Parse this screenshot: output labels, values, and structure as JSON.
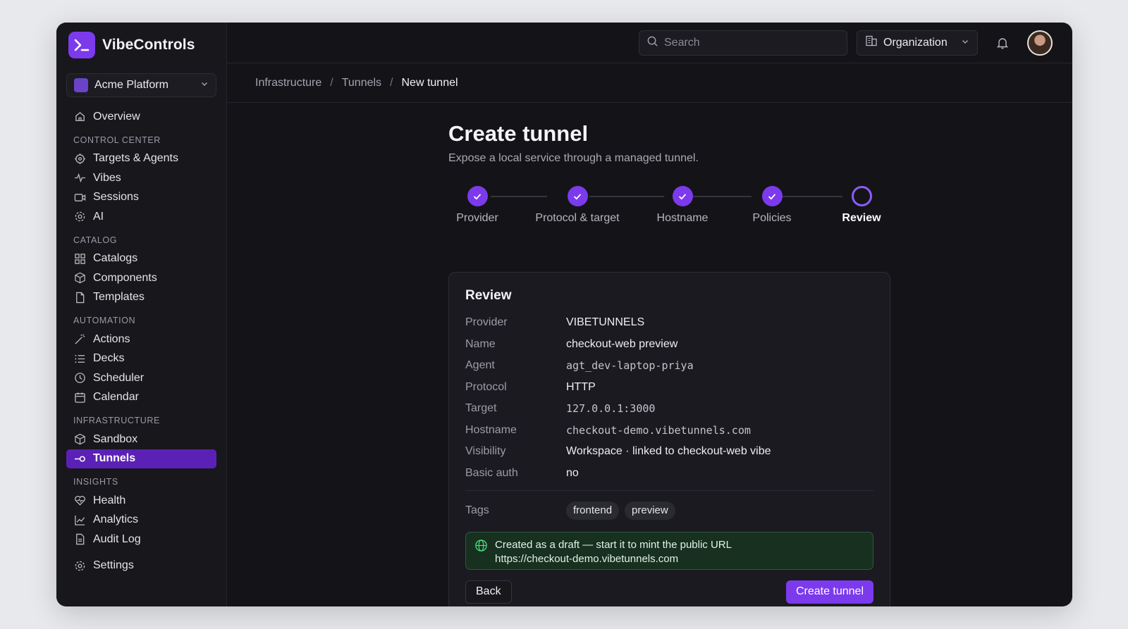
{
  "brand": {
    "name": "VibeControls",
    "logo_icon": "terminal-prompt-icon"
  },
  "workspace": {
    "name": "Acme Platform"
  },
  "sidebar": {
    "overview": "Overview",
    "sections": [
      {
        "label": "CONTROL CENTER",
        "items": [
          "Targets & Agents",
          "Vibes",
          "Sessions",
          "AI"
        ]
      },
      {
        "label": "CATALOG",
        "items": [
          "Catalogs",
          "Components",
          "Templates"
        ]
      },
      {
        "label": "AUTOMATION",
        "items": [
          "Actions",
          "Decks",
          "Scheduler",
          "Calendar"
        ]
      },
      {
        "label": "INFRASTRUCTURE",
        "items": [
          "Sandbox",
          "Tunnels"
        ]
      },
      {
        "label": "INSIGHTS",
        "items": [
          "Health",
          "Analytics",
          "Audit Log"
        ]
      }
    ],
    "settings": "Settings",
    "active_item": "Tunnels"
  },
  "topbar": {
    "search_placeholder": "Search",
    "org_label": "Organization"
  },
  "breadcrumb": [
    "Infrastructure",
    "Tunnels",
    "New tunnel"
  ],
  "page": {
    "title": "Create tunnel",
    "subtitle": "Expose a local service through a managed tunnel."
  },
  "steps": [
    {
      "label": "Provider",
      "status": "done"
    },
    {
      "label": "Protocol & target",
      "status": "done"
    },
    {
      "label": "Hostname",
      "status": "done"
    },
    {
      "label": "Policies",
      "status": "done"
    },
    {
      "label": "Review",
      "status": "current"
    }
  ],
  "review": {
    "title": "Review",
    "rows": [
      {
        "key": "Provider",
        "value": "VIBETUNNELS"
      },
      {
        "key": "Name",
        "value": "checkout-web preview"
      },
      {
        "key": "Agent",
        "value": "agt_dev-laptop-priya"
      },
      {
        "key": "Protocol",
        "value": "HTTP"
      },
      {
        "key": "Target",
        "value": "127.0.0.1:3000"
      },
      {
        "key": "Hostname",
        "value": "checkout-demo.vibetunnels.com"
      },
      {
        "key": "Visibility",
        "value": "Workspace · linked to checkout-web vibe"
      },
      {
        "key": "Basic auth",
        "value": "no"
      }
    ],
    "tags_label": "Tags",
    "tags": [
      "frontend",
      "preview"
    ],
    "notice_line1": "Created as a draft — start it to mint the public URL",
    "notice_line2": "https://checkout-demo.vibetunnels.com"
  },
  "buttons": {
    "back": "Back",
    "create": "Create tunnel"
  },
  "colors": {
    "accent": "#7c3aed",
    "active_nav": "#5b21b6",
    "notice_bg": "#17301f"
  }
}
